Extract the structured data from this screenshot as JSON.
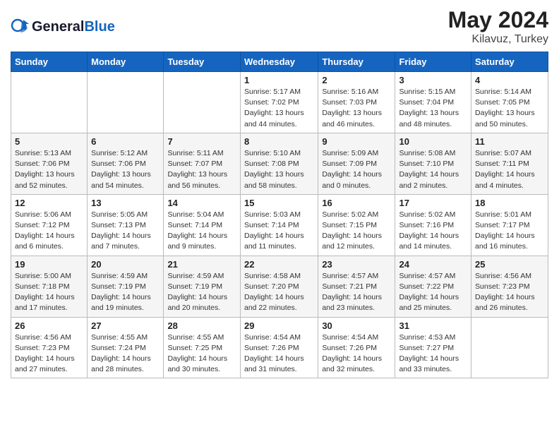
{
  "header": {
    "logo_general": "General",
    "logo_blue": "Blue",
    "month": "May 2024",
    "location": "Kilavuz, Turkey"
  },
  "weekdays": [
    "Sunday",
    "Monday",
    "Tuesday",
    "Wednesday",
    "Thursday",
    "Friday",
    "Saturday"
  ],
  "weeks": [
    [
      {
        "day": "",
        "sunrise": "",
        "sunset": "",
        "daylight": ""
      },
      {
        "day": "",
        "sunrise": "",
        "sunset": "",
        "daylight": ""
      },
      {
        "day": "",
        "sunrise": "",
        "sunset": "",
        "daylight": ""
      },
      {
        "day": "1",
        "sunrise": "Sunrise: 5:17 AM",
        "sunset": "Sunset: 7:02 PM",
        "daylight": "Daylight: 13 hours and 44 minutes."
      },
      {
        "day": "2",
        "sunrise": "Sunrise: 5:16 AM",
        "sunset": "Sunset: 7:03 PM",
        "daylight": "Daylight: 13 hours and 46 minutes."
      },
      {
        "day": "3",
        "sunrise": "Sunrise: 5:15 AM",
        "sunset": "Sunset: 7:04 PM",
        "daylight": "Daylight: 13 hours and 48 minutes."
      },
      {
        "day": "4",
        "sunrise": "Sunrise: 5:14 AM",
        "sunset": "Sunset: 7:05 PM",
        "daylight": "Daylight: 13 hours and 50 minutes."
      }
    ],
    [
      {
        "day": "5",
        "sunrise": "Sunrise: 5:13 AM",
        "sunset": "Sunset: 7:06 PM",
        "daylight": "Daylight: 13 hours and 52 minutes."
      },
      {
        "day": "6",
        "sunrise": "Sunrise: 5:12 AM",
        "sunset": "Sunset: 7:06 PM",
        "daylight": "Daylight: 13 hours and 54 minutes."
      },
      {
        "day": "7",
        "sunrise": "Sunrise: 5:11 AM",
        "sunset": "Sunset: 7:07 PM",
        "daylight": "Daylight: 13 hours and 56 minutes."
      },
      {
        "day": "8",
        "sunrise": "Sunrise: 5:10 AM",
        "sunset": "Sunset: 7:08 PM",
        "daylight": "Daylight: 13 hours and 58 minutes."
      },
      {
        "day": "9",
        "sunrise": "Sunrise: 5:09 AM",
        "sunset": "Sunset: 7:09 PM",
        "daylight": "Daylight: 14 hours and 0 minutes."
      },
      {
        "day": "10",
        "sunrise": "Sunrise: 5:08 AM",
        "sunset": "Sunset: 7:10 PM",
        "daylight": "Daylight: 14 hours and 2 minutes."
      },
      {
        "day": "11",
        "sunrise": "Sunrise: 5:07 AM",
        "sunset": "Sunset: 7:11 PM",
        "daylight": "Daylight: 14 hours and 4 minutes."
      }
    ],
    [
      {
        "day": "12",
        "sunrise": "Sunrise: 5:06 AM",
        "sunset": "Sunset: 7:12 PM",
        "daylight": "Daylight: 14 hours and 6 minutes."
      },
      {
        "day": "13",
        "sunrise": "Sunrise: 5:05 AM",
        "sunset": "Sunset: 7:13 PM",
        "daylight": "Daylight: 14 hours and 7 minutes."
      },
      {
        "day": "14",
        "sunrise": "Sunrise: 5:04 AM",
        "sunset": "Sunset: 7:14 PM",
        "daylight": "Daylight: 14 hours and 9 minutes."
      },
      {
        "day": "15",
        "sunrise": "Sunrise: 5:03 AM",
        "sunset": "Sunset: 7:14 PM",
        "daylight": "Daylight: 14 hours and 11 minutes."
      },
      {
        "day": "16",
        "sunrise": "Sunrise: 5:02 AM",
        "sunset": "Sunset: 7:15 PM",
        "daylight": "Daylight: 14 hours and 12 minutes."
      },
      {
        "day": "17",
        "sunrise": "Sunrise: 5:02 AM",
        "sunset": "Sunset: 7:16 PM",
        "daylight": "Daylight: 14 hours and 14 minutes."
      },
      {
        "day": "18",
        "sunrise": "Sunrise: 5:01 AM",
        "sunset": "Sunset: 7:17 PM",
        "daylight": "Daylight: 14 hours and 16 minutes."
      }
    ],
    [
      {
        "day": "19",
        "sunrise": "Sunrise: 5:00 AM",
        "sunset": "Sunset: 7:18 PM",
        "daylight": "Daylight: 14 hours and 17 minutes."
      },
      {
        "day": "20",
        "sunrise": "Sunrise: 4:59 AM",
        "sunset": "Sunset: 7:19 PM",
        "daylight": "Daylight: 14 hours and 19 minutes."
      },
      {
        "day": "21",
        "sunrise": "Sunrise: 4:59 AM",
        "sunset": "Sunset: 7:19 PM",
        "daylight": "Daylight: 14 hours and 20 minutes."
      },
      {
        "day": "22",
        "sunrise": "Sunrise: 4:58 AM",
        "sunset": "Sunset: 7:20 PM",
        "daylight": "Daylight: 14 hours and 22 minutes."
      },
      {
        "day": "23",
        "sunrise": "Sunrise: 4:57 AM",
        "sunset": "Sunset: 7:21 PM",
        "daylight": "Daylight: 14 hours and 23 minutes."
      },
      {
        "day": "24",
        "sunrise": "Sunrise: 4:57 AM",
        "sunset": "Sunset: 7:22 PM",
        "daylight": "Daylight: 14 hours and 25 minutes."
      },
      {
        "day": "25",
        "sunrise": "Sunrise: 4:56 AM",
        "sunset": "Sunset: 7:23 PM",
        "daylight": "Daylight: 14 hours and 26 minutes."
      }
    ],
    [
      {
        "day": "26",
        "sunrise": "Sunrise: 4:56 AM",
        "sunset": "Sunset: 7:23 PM",
        "daylight": "Daylight: 14 hours and 27 minutes."
      },
      {
        "day": "27",
        "sunrise": "Sunrise: 4:55 AM",
        "sunset": "Sunset: 7:24 PM",
        "daylight": "Daylight: 14 hours and 28 minutes."
      },
      {
        "day": "28",
        "sunrise": "Sunrise: 4:55 AM",
        "sunset": "Sunset: 7:25 PM",
        "daylight": "Daylight: 14 hours and 30 minutes."
      },
      {
        "day": "29",
        "sunrise": "Sunrise: 4:54 AM",
        "sunset": "Sunset: 7:26 PM",
        "daylight": "Daylight: 14 hours and 31 minutes."
      },
      {
        "day": "30",
        "sunrise": "Sunrise: 4:54 AM",
        "sunset": "Sunset: 7:26 PM",
        "daylight": "Daylight: 14 hours and 32 minutes."
      },
      {
        "day": "31",
        "sunrise": "Sunrise: 4:53 AM",
        "sunset": "Sunset: 7:27 PM",
        "daylight": "Daylight: 14 hours and 33 minutes."
      },
      {
        "day": "",
        "sunrise": "",
        "sunset": "",
        "daylight": ""
      }
    ]
  ]
}
